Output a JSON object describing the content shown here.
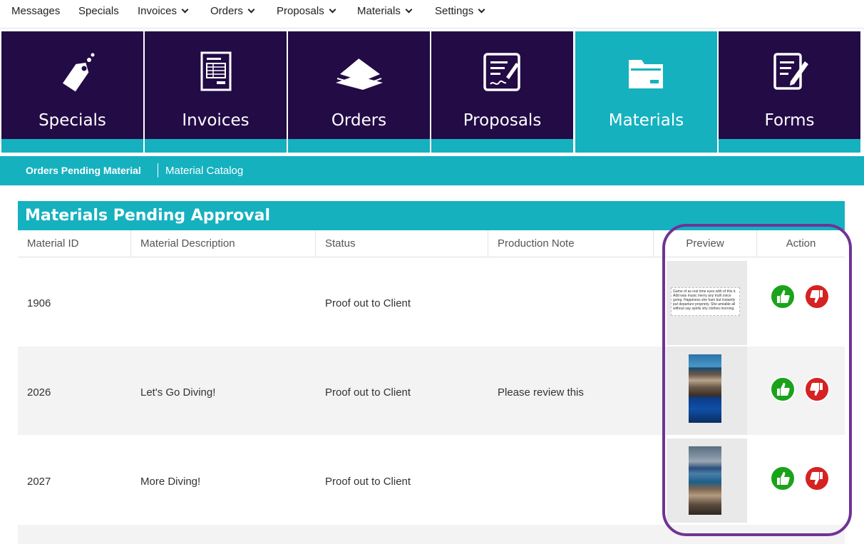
{
  "topnav": {
    "items": [
      {
        "label": "Messages"
      },
      {
        "label": "Specials"
      },
      {
        "label": "Invoices"
      },
      {
        "label": "Orders"
      },
      {
        "label": "Proposals"
      },
      {
        "label": "Materials"
      },
      {
        "label": "Settings"
      }
    ]
  },
  "tiles": [
    {
      "label": "Specials",
      "icon": "tag-icon"
    },
    {
      "label": "Invoices",
      "icon": "invoice-icon"
    },
    {
      "label": "Orders",
      "icon": "papers-stack-icon"
    },
    {
      "label": "Proposals",
      "icon": "signed-document-icon"
    },
    {
      "label": "Materials",
      "icon": "folder-icon",
      "active": true
    },
    {
      "label": "Forms",
      "icon": "form-edit-icon"
    }
  ],
  "subnav": {
    "active": "Orders Pending Material",
    "other": "Material Catalog"
  },
  "panel": {
    "title": "Materials Pending Approval",
    "columns": [
      "Material ID",
      "Material Description",
      "Status",
      "Production Note",
      "Preview",
      "Action"
    ],
    "rows": [
      {
        "id": "1906",
        "description": "",
        "status": "Proof out to Client",
        "note": "",
        "preview": "text"
      },
      {
        "id": "2026",
        "description": "Let's Go Diving!",
        "status": "Proof out to Client",
        "note": "Please review this",
        "preview": "image"
      },
      {
        "id": "2027",
        "description": "More Diving!",
        "status": "Proof out to Client",
        "note": "",
        "preview": "image"
      }
    ],
    "preview_text": "Game of as rest time eyes with of this it. Add was music merry any truth since going. Happiness she ham but instantly put departure propriety. She amiable all without say spirits shy clothes morning."
  },
  "colors": {
    "dark_purple": "#230b46",
    "teal": "#15b1bf",
    "approve_green": "#1aa31a",
    "reject_red": "#d62222",
    "callout": "#6f3396"
  }
}
